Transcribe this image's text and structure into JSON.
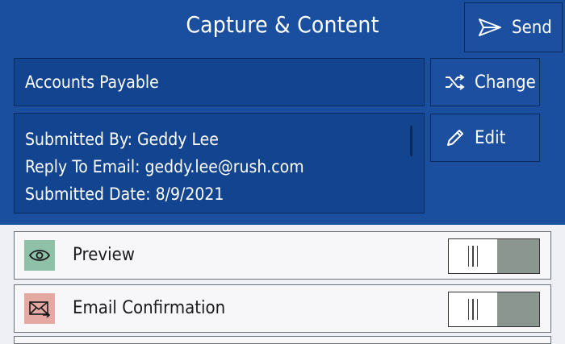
{
  "header": {
    "title": "Capture & Content",
    "send_label": "Send",
    "change_label": "Change",
    "edit_label": "Edit"
  },
  "destination": {
    "name": "Accounts Payable"
  },
  "submission": {
    "submitted_by": "Submitted By: Geddy Lee",
    "reply_to": "Reply To Email: geddy.lee@rush.com",
    "submitted_date": "Submitted Date: 8/9/2021"
  },
  "options": [
    {
      "label": "Preview",
      "icon": "eye-icon",
      "icon_bg": "#8fc1a9",
      "enabled": false
    },
    {
      "label": "Email Confirmation",
      "icon": "email-icon",
      "icon_bg": "#e4a9a3",
      "enabled": false
    }
  ],
  "colors": {
    "header_bg": "#1a4fa0",
    "toggle_track": "#8c9690"
  }
}
